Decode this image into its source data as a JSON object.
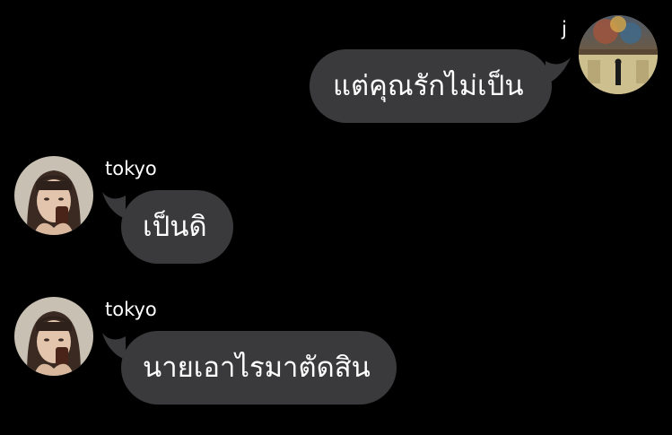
{
  "colors": {
    "background": "#000000",
    "bubble": "#3a3a3c",
    "text": "#ffffff"
  },
  "messages": [
    {
      "sender": "j",
      "side": "outgoing",
      "text": "แต่คุณรักไม่เป็น",
      "avatar": "stage-scene-avatar"
    },
    {
      "sender": "tokyo",
      "side": "incoming",
      "text": "เป็นดิ",
      "avatar": "woman-portrait-avatar"
    },
    {
      "sender": "tokyo",
      "side": "incoming",
      "text": "นายเอาไรมาตัดสิน",
      "avatar": "woman-portrait-avatar"
    }
  ]
}
